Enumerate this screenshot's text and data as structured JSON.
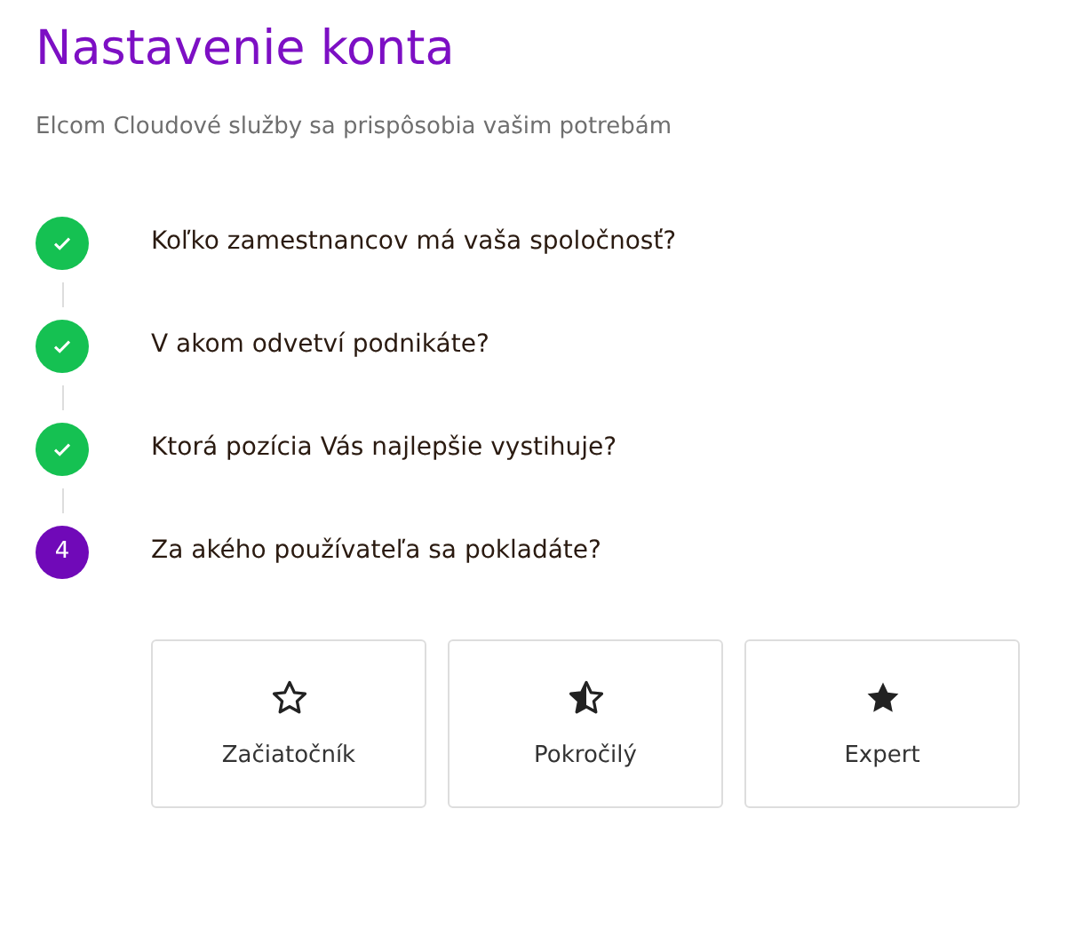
{
  "title": "Nastavenie konta",
  "subtitle": "Elcom Cloudové služby sa prispôsobia vašim potrebám",
  "steps": [
    {
      "kind": "done",
      "label": "Koľko zamestnancov má vaša spoločnosť?"
    },
    {
      "kind": "done",
      "label": "V akom odvetví podnikáte?"
    },
    {
      "kind": "done",
      "label": "Ktorá pozícia Vás najlepšie vystihuje?"
    },
    {
      "kind": "current",
      "number": "4",
      "label": "Za akého používateľa sa pokladáte?"
    }
  ],
  "options": [
    {
      "kind": "empty",
      "label": "Začiatočník"
    },
    {
      "kind": "half",
      "label": "Pokročilý"
    },
    {
      "kind": "full",
      "label": "Expert"
    }
  ]
}
